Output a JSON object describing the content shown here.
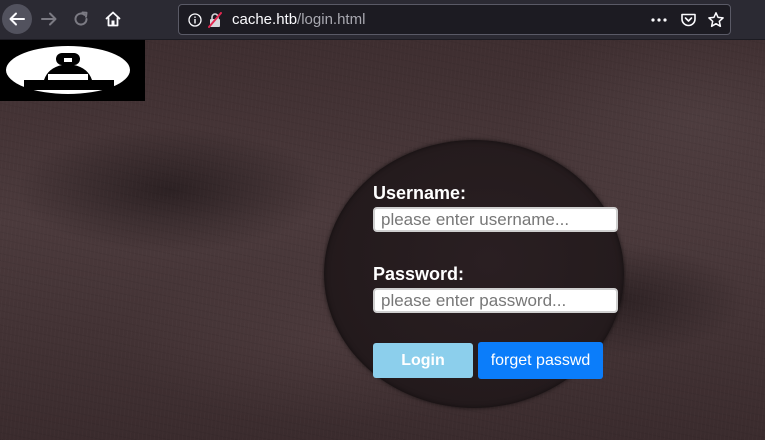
{
  "browser": {
    "url_host": "cache.htb",
    "url_path": "/login.html",
    "icons": {
      "back": "back-arrow-icon",
      "forward": "forward-arrow-icon",
      "reload": "reload-icon",
      "home": "home-icon",
      "info": "info-icon",
      "insecure": "insecure-connection-icon",
      "page_actions": "more-dots-icon",
      "pocket": "pocket-icon",
      "bookmark": "star-icon"
    }
  },
  "page": {
    "logo": "logo-icon",
    "username_label": "Username:",
    "username_placeholder": "please enter username...",
    "username_value": "",
    "password_label": "Password:",
    "password_placeholder": "please enter password...",
    "password_value": "",
    "login_button": "Login",
    "forget_button": "forget passwd"
  },
  "colors": {
    "toolbar_bg": "#2b2a33",
    "urlbar_bg": "#1c1b22",
    "page_bg": "#443436",
    "circle_bg": "#231a1c",
    "login_button_bg": "#8ccfec",
    "forget_button_bg": "#0b7dfa"
  }
}
